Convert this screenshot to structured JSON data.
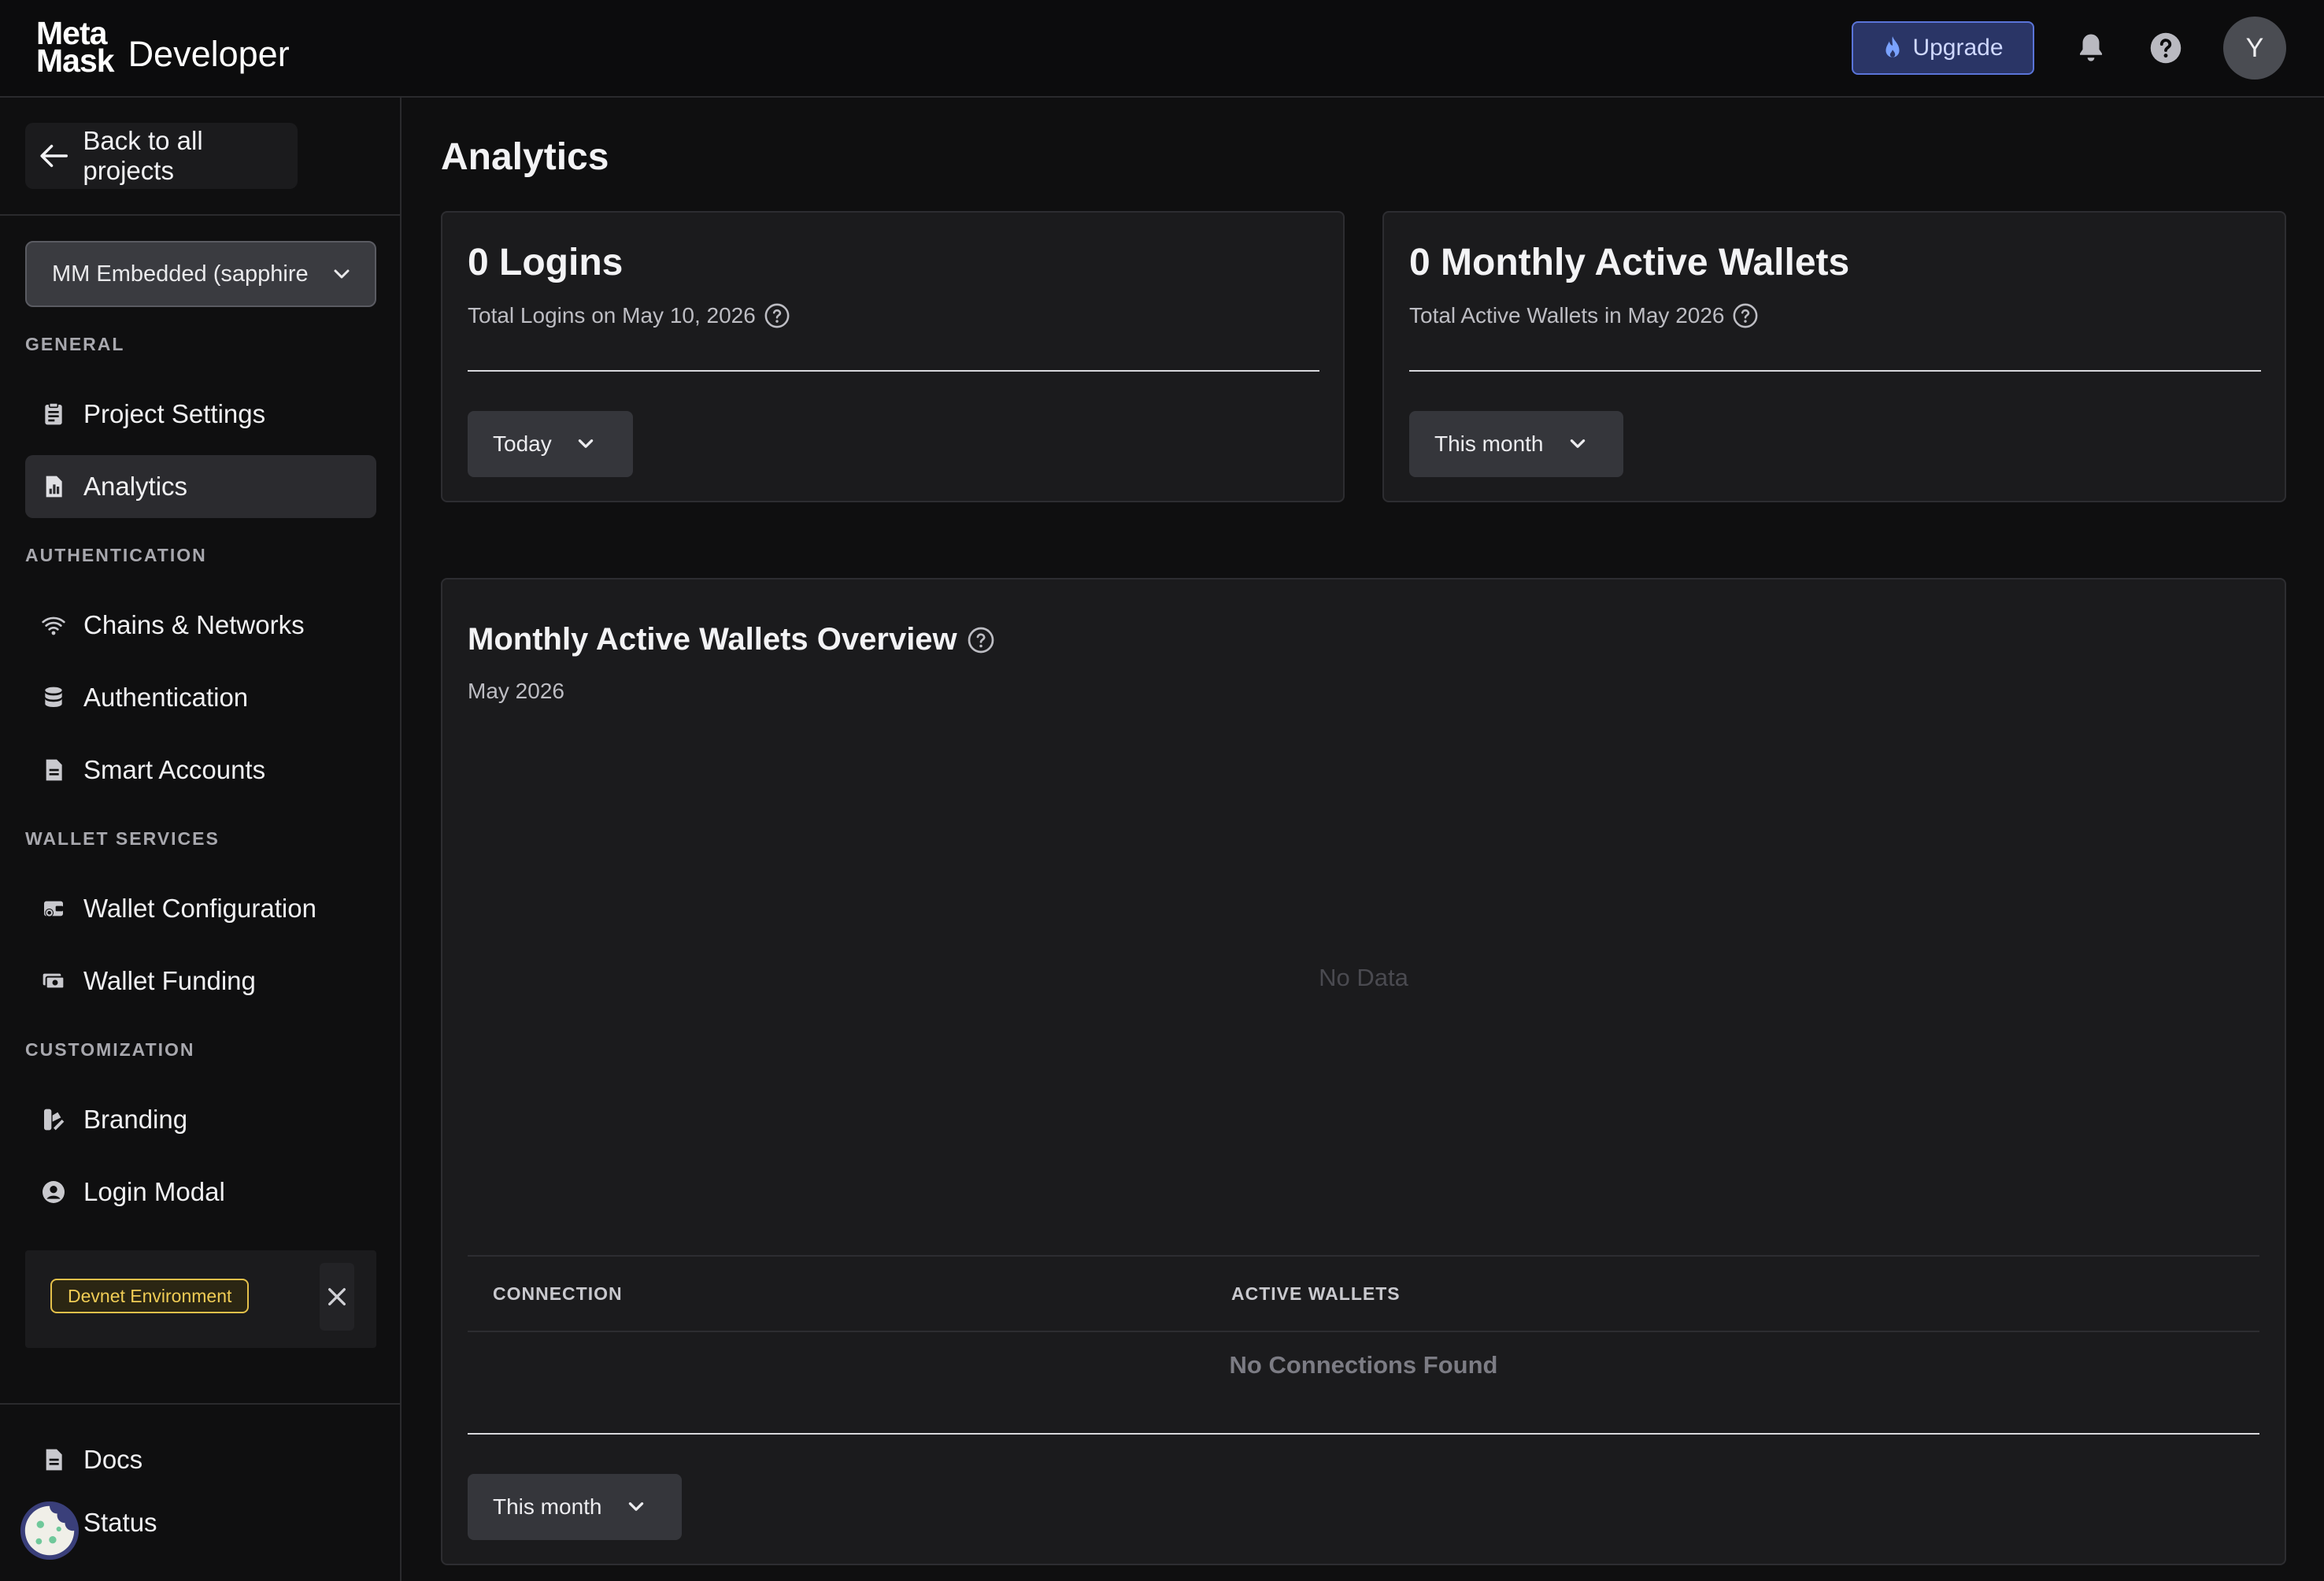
{
  "header": {
    "logo_line1": "Meta",
    "logo_line2": "Mask",
    "logo_suffix": "Developer",
    "upgrade_label": "Upgrade",
    "avatar_initial": "Y"
  },
  "sidebar": {
    "back_label": "Back to all projects",
    "project_select_value": "MM Embedded (sapphire",
    "sections": {
      "general": "GENERAL",
      "authentication": "AUTHENTICATION",
      "wallet_services": "WALLET SERVICES",
      "customization": "CUSTOMIZATION"
    },
    "items": {
      "project_settings": "Project Settings",
      "analytics": "Analytics",
      "chains_networks": "Chains & Networks",
      "authentication": "Authentication",
      "smart_accounts": "Smart Accounts",
      "wallet_configuration": "Wallet Configuration",
      "wallet_funding": "Wallet Funding",
      "branding": "Branding",
      "login_modal": "Login Modal",
      "docs": "Docs",
      "status": "Status"
    },
    "active_item": "Analytics",
    "environment_badge": "Devnet Environment"
  },
  "main": {
    "page_title": "Analytics",
    "logins_card": {
      "value": "0 Logins",
      "subtitle": "Total Logins on May 10, 2026",
      "period": "Today"
    },
    "maw_card": {
      "value": "0 Monthly Active Wallets",
      "subtitle": "Total Active Wallets in May 2026",
      "period": "This month"
    },
    "overview": {
      "title": "Monthly Active Wallets Overview",
      "subtitle": "May 2026",
      "empty_chart_text": "No Data",
      "table_headers": [
        "CONNECTION",
        "ACTIVE WALLETS"
      ],
      "empty_table_text": "No Connections Found",
      "period": "This month"
    }
  },
  "colors": {
    "background": "#0f0f10",
    "card": "#1b1b1d",
    "upgrade_bg": "#2a3566",
    "upgrade_border": "#5a74d8",
    "devnet_yellow": "#f0cc55"
  }
}
